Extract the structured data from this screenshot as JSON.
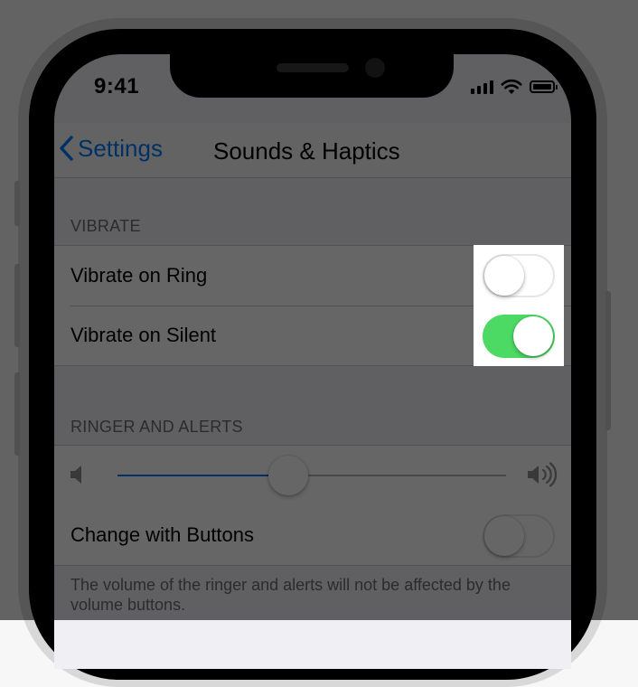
{
  "status_bar": {
    "time": "9:41",
    "signal_icon": "signal-bars-icon",
    "wifi_icon": "wifi-icon",
    "battery_icon": "battery-icon"
  },
  "nav": {
    "back_label": "Settings",
    "back_icon": "chevron-left-icon",
    "title": "Sounds & Haptics"
  },
  "vibrate": {
    "header": "VIBRATE",
    "items": [
      {
        "label": "Vibrate on Ring",
        "on": false
      },
      {
        "label": "Vibrate on Silent",
        "on": true
      }
    ]
  },
  "ringer": {
    "header": "RINGER AND ALERTS",
    "volume_low_icon": "speaker-low-icon",
    "volume_high_icon": "speaker-high-icon",
    "volume_level": 0.44,
    "change_with_buttons": {
      "label": "Change with Buttons",
      "on": false
    },
    "footer": "The volume of the ringer and alerts will not be affected by the volume buttons."
  },
  "colors": {
    "accent": "#007aff",
    "switch_on": "#4cd964",
    "background": "#efeff4"
  }
}
